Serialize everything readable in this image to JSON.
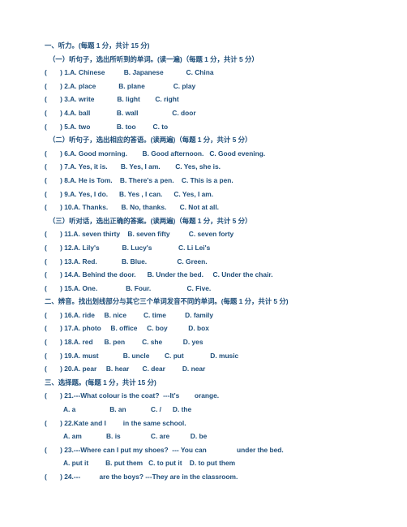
{
  "document": {
    "type": "exam-paper",
    "language": "zh-CN / en",
    "text_color": "#1f4e79",
    "background_color": "#ffffff"
  },
  "sections": [
    {
      "heading": "一、听力。(每题 1 分，共计 15 分)",
      "subsections": [
        {
          "heading": "（一）听句子，选出所听到的单词。(读一遍)（每题 1 分，共计 5 分）",
          "questions": [
            {
              "marker": "(       ) 1.",
              "text": "A. Chinese          B. Japanese            C. China"
            },
            {
              "marker": "(       ) 2.",
              "text": "A. place            B. plane               C. play"
            },
            {
              "marker": "(       ) 3.",
              "text": "A. write            B. light        C. right"
            },
            {
              "marker": "(       ) 4.",
              "text": "A. ball              B. wall                  C. door"
            },
            {
              "marker": "(       ) 5.",
              "text": "A. two              B. too         C. to"
            }
          ]
        },
        {
          "heading": "（二）听句子，选出相应的答语。(读两遍)（每题 1 分，共计 5 分）",
          "questions": [
            {
              "marker": "(       ) 6.",
              "text": "A. Good morning.        B. Good afternoon.   C. Good evening."
            },
            {
              "marker": "(       ) 7.",
              "text": "A. Yes, it is.       B. Yes, I am.        C. Yes, she is."
            },
            {
              "marker": "(       ) 8.",
              "text": "A. He is Tom.    B. There's a pen.    C. This is a pen."
            },
            {
              "marker": "(       ) 9.",
              "text": "A. Yes, I do.      B. Yes , I can.      C. Yes, I am."
            },
            {
              "marker": "(       ) 10.",
              "text": "A. Thanks.       B. No, thanks.       C. Not at all."
            }
          ]
        },
        {
          "heading": "（三）听对话，选出正确的答案。(读两遍)（每题 1 分，共计 5 分）",
          "questions": [
            {
              "marker": "(       ) 11.",
              "text": "A. seven thirty    B. seven fifty          C. seven forty"
            },
            {
              "marker": "(       ) 12.",
              "text": "A. Lily's            B. Lucy's              C. Li Lei's"
            },
            {
              "marker": "(       ) 13.",
              "text": "A. Red.             B. Blue.                C. Green."
            },
            {
              "marker": "(       ) 14.",
              "text": "A. Behind the door.      B. Under the bed.     C. Under the chair."
            },
            {
              "marker": "(       ) 15.",
              "text": "A. One.               B. Four.                   C. Five."
            }
          ]
        }
      ]
    },
    {
      "heading": "二、辨音。找出划线部分与其它三个单词发音不同的单词。(每题 1 分，共计 5 分)",
      "subsections": [
        {
          "heading": "",
          "questions": [
            {
              "marker": "(       ) 16.",
              "text": "A. ride     B. nice         C. time          D. family"
            },
            {
              "marker": "(       ) 17.",
              "text": "A. photo     B. office     C. boy           D. box"
            },
            {
              "marker": "(       ) 18.",
              "text": "A. red      B. pen         C. she           D. yes"
            },
            {
              "marker": "(       ) 19.",
              "text": "A. must             B. uncle        C. put              D. music"
            },
            {
              "marker": "(       ) 20.",
              "text": "A. pear     B. hear       C. dear         D. near"
            }
          ]
        }
      ]
    },
    {
      "heading": "三、选择题。(每题 1 分，共计 15 分)",
      "subsections": [
        {
          "heading": "",
          "questions": [
            {
              "marker": "(       ) 21.",
              "text": "---What colour is the coat?  ---It's        orange.",
              "options": "          A. a                  B. an             C. /      D. the"
            },
            {
              "marker": "(       ) 22.",
              "text": "Kate and I         in the same school.",
              "options": "          A. am             B. is                C. are           D. be"
            },
            {
              "marker": "(       ) 23.",
              "text": "---Where can I put my shoes?  --- You can                under the bed.",
              "options": "          A. put it         B. put them   C. to put it    D. to put them"
            },
            {
              "marker": "(       ) 24.",
              "text": "---          are the boys? ---They are in the classroom.",
              "options": ""
            }
          ]
        }
      ]
    }
  ]
}
